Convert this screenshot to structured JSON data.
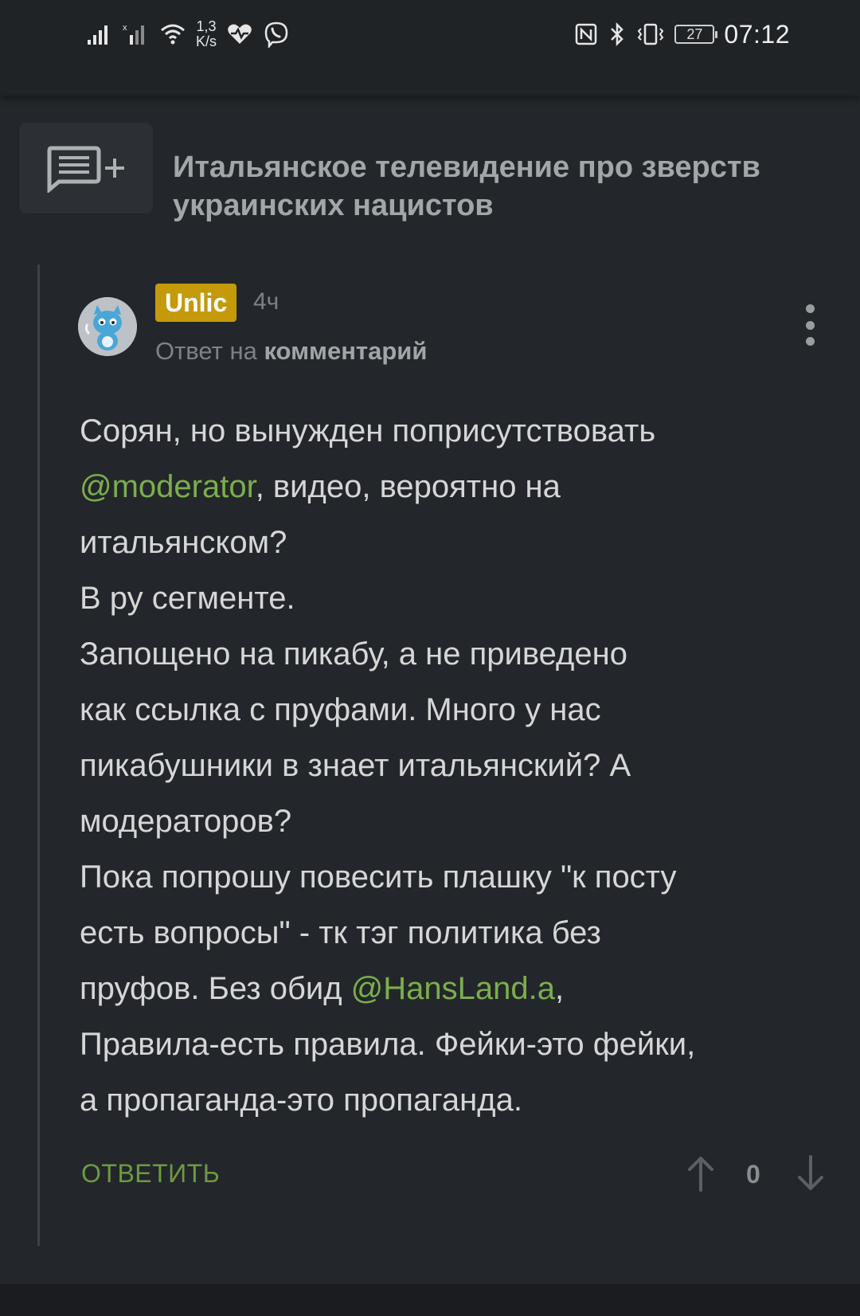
{
  "status_bar": {
    "net_speed_value": "1,3",
    "net_speed_unit": "K/s",
    "battery": "27",
    "time": "07:12"
  },
  "post": {
    "title": "Итальянское телевидение про зверств украинских нацистов"
  },
  "comment": {
    "username": "Unlic",
    "time": "4ч",
    "reply_prefix": "Ответ на",
    "reply_target": "комментарий",
    "lines": {
      "l1": "Сорян, но вынужден поприсутствовать",
      "l2_mention": "@moderator",
      "l2_rest": ", видео, вероятно на",
      "l3": "итальянском?",
      "l4": "В ру сегменте.",
      "l5": "Запощено на пикабу, а не приведено",
      "l6": "как ссылка с пруфами. Много у нас",
      "l7": "пикабушники в знает итальянский? А",
      "l8": "модераторов?",
      "l9": "Пока попрошу повесить плашку \"к посту",
      "l10": "есть вопросы\" - тк тэг политика без",
      "l11_start": "пруфов. Без обид ",
      "l11_mention": "@HansLand.a",
      "l11_end": ",",
      "l12": "Правила-есть правила. Фейки-это фейки,",
      "l13": "а пропаганда-это пропаганда."
    },
    "reply_label": "ОТВЕТИТЬ",
    "rating": "0"
  },
  "colors": {
    "background": "#23272b",
    "mention": "#7cae4c",
    "reply_action": "#6e9a3f",
    "username_badge": "#c49a0a"
  },
  "icons": [
    "signal-icon",
    "wifi-icon",
    "heart-monitor-icon",
    "viber-icon",
    "nfc-icon",
    "bluetooth-icon",
    "vibrate-icon",
    "battery-icon",
    "add-comment-icon",
    "more-vertical-icon",
    "arrow-up-icon",
    "arrow-down-icon"
  ]
}
